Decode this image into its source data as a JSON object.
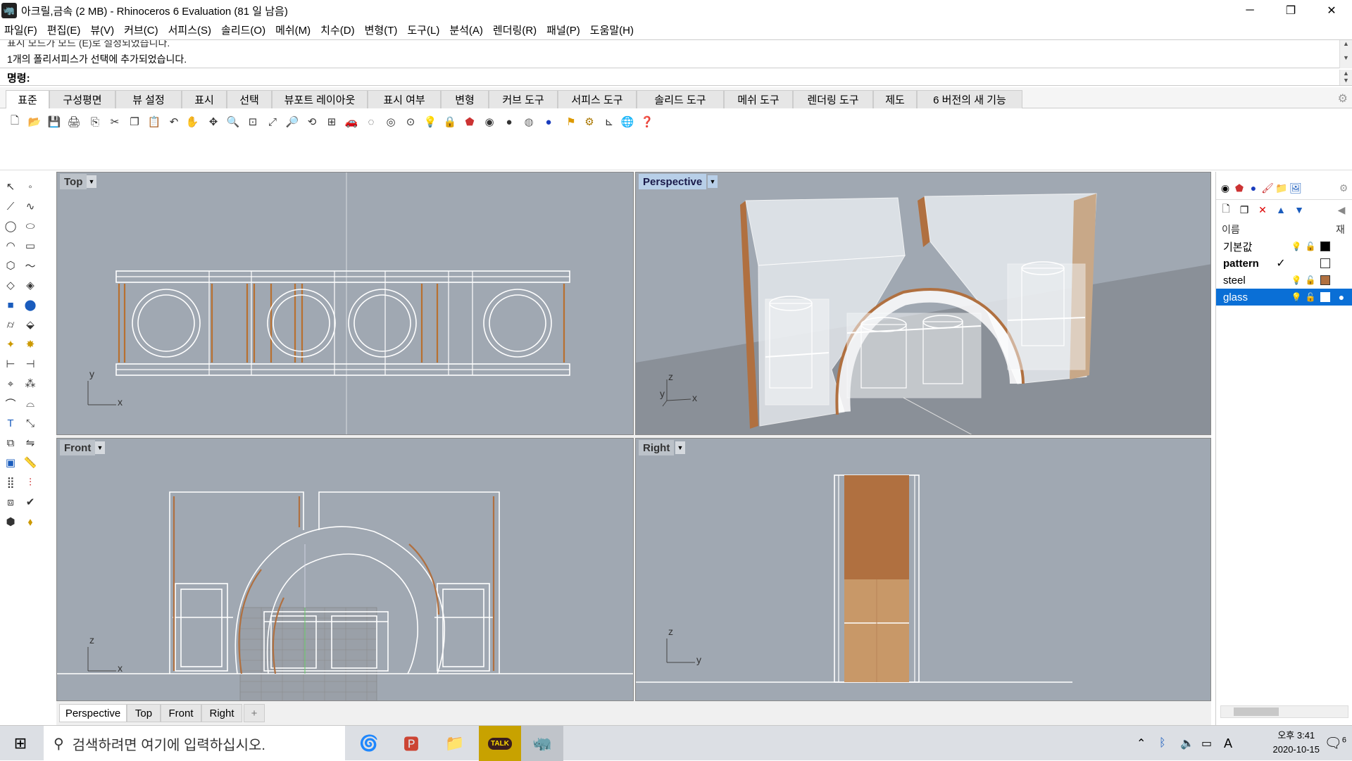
{
  "window": {
    "title": "아크릴,금속 (2 MB) - Rhinoceros 6 Evaluation (81 일 남음)",
    "minimize": "─",
    "maximize": "❐",
    "close": "✕"
  },
  "menu": [
    "파일(F)",
    "편집(E)",
    "뷰(V)",
    "커브(C)",
    "서피스(S)",
    "솔리드(O)",
    "메쉬(M)",
    "치수(D)",
    "변형(T)",
    "도구(L)",
    "분석(A)",
    "렌더링(R)",
    "패널(P)",
    "도움말(H)"
  ],
  "command": {
    "history_partial": "표시 모드가 모드 (E)로 설정되었습니다.",
    "history_last": "1개의 폴리서피스가 선택에 추가되었습니다.",
    "prompt": "명령:"
  },
  "tabs": [
    "표준",
    "구성평면",
    "뷰 설정",
    "표시",
    "선택",
    "뷰포트 레이아웃",
    "표시 여부",
    "변형",
    "커브 도구",
    "서피스 도구",
    "솔리드 도구",
    "메쉬 도구",
    "렌더링 도구",
    "제도",
    "6 버전의 새 기능"
  ],
  "active_tab": "표준",
  "toolbar_icons": [
    "new-file-icon",
    "open-icon",
    "save-icon",
    "print-icon",
    "import-icon",
    "cut-icon",
    "copy-icon",
    "paste-icon",
    "undo-icon",
    "pan-icon",
    "rotate-view-icon",
    "zoom-icon",
    "zoom-window-icon",
    "zoom-extents-icon",
    "zoom-selected-icon",
    "rotate-3d-icon",
    "viewport-layout-icon",
    "car-icon",
    "hide-icon",
    "show-icon",
    "osnap-icon",
    "light-icon",
    "lock-icon",
    "material-icon",
    "color-wheel-icon",
    "sphere-icon",
    "shaded-sphere-icon",
    "blue-sphere-icon",
    "history-icon",
    "settings-gear-icon",
    "osnap-grid-icon",
    "render-globe-icon",
    "help-icon"
  ],
  "viewports": {
    "top": {
      "label": "Top",
      "axis_x": "x",
      "axis_y": "y"
    },
    "perspective": {
      "label": "Perspective",
      "axis_x": "x",
      "axis_y": "y",
      "axis_z": "z"
    },
    "front": {
      "label": "Front",
      "axis_x": "x",
      "axis_z": "z"
    },
    "right": {
      "label": "Right",
      "axis_y": "y",
      "axis_z": "z"
    }
  },
  "viewport_tabs": [
    "Perspective",
    "Top",
    "Front",
    "Right"
  ],
  "viewport_tab_add": "+",
  "layers_panel": {
    "header_name": "이름",
    "header_material": "재",
    "layers": [
      {
        "name": "기본값",
        "color": "#000000",
        "current": false,
        "bold": false,
        "selected": false
      },
      {
        "name": "pattern",
        "color": "#ffffff",
        "current": true,
        "bold": true,
        "selected": false
      },
      {
        "name": "steel",
        "color": "#b07040",
        "current": false,
        "bold": false,
        "selected": false
      },
      {
        "name": "glass",
        "color": "#ffffff",
        "current": false,
        "bold": false,
        "selected": true
      }
    ],
    "current_mark": "✓"
  },
  "taskbar": {
    "search_placeholder": "검색하려면 여기에 입력하십시오.",
    "time": "오후 3:41",
    "date": "2020-10-15",
    "ime": "A",
    "notification_count": "6",
    "kakao_label": "TALK"
  },
  "colors": {
    "viewport_bg": "#a0a8b2",
    "accent": "#0a6fd6",
    "steel": "#b07040"
  }
}
